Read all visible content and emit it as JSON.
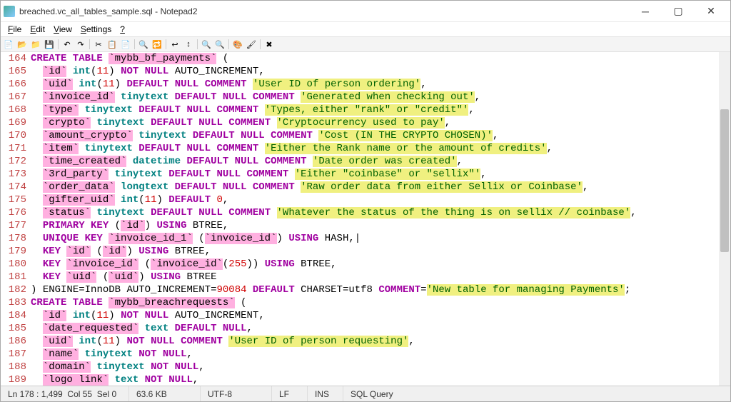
{
  "window": {
    "title": "breached.vc_all_tables_sample.sql - Notepad2"
  },
  "menu": {
    "file": "File",
    "edit": "Edit",
    "view": "View",
    "settings": "Settings",
    "help": "?"
  },
  "toolbar": {
    "icons": [
      "new-icon",
      "open-icon",
      "browse-icon",
      "save-icon",
      "sep",
      "undo-icon",
      "redo-icon",
      "sep",
      "cut-icon",
      "copy-icon",
      "paste-icon",
      "sep",
      "find-icon",
      "replace-icon",
      "sep",
      "wordwrap-icon",
      "wrapline-icon",
      "sep",
      "zoomin-icon",
      "zoomout-icon",
      "sep",
      "scheme-icon",
      "scheme2-icon",
      "sep",
      "exit-icon"
    ]
  },
  "lines": [
    {
      "n": 164,
      "tokens": [
        [
          "kw",
          "CREATE TABLE "
        ],
        [
          "ident",
          "`mybb_bf_payments`"
        ],
        [
          "pn",
          " ("
        ]
      ]
    },
    {
      "n": 165,
      "tokens": [
        [
          "pn",
          "  "
        ],
        [
          "ident",
          "`id`"
        ],
        [
          "pn",
          " "
        ],
        [
          "dtype",
          "int"
        ],
        [
          "pn",
          "("
        ],
        [
          "num",
          "11"
        ],
        [
          "pn",
          ") "
        ],
        [
          "attr",
          "NOT NULL"
        ],
        [
          "pn",
          " "
        ],
        [
          "fn",
          "AUTO_INCREMENT"
        ],
        [
          "pn",
          ","
        ]
      ]
    },
    {
      "n": 166,
      "tokens": [
        [
          "pn",
          "  "
        ],
        [
          "ident",
          "`uid`"
        ],
        [
          "pn",
          " "
        ],
        [
          "dtype",
          "int"
        ],
        [
          "pn",
          "("
        ],
        [
          "num",
          "11"
        ],
        [
          "pn",
          ") "
        ],
        [
          "attr",
          "DEFAULT NULL"
        ],
        [
          "pn",
          " "
        ],
        [
          "kw",
          "COMMENT "
        ],
        [
          "str",
          "'User ID of person ordering'"
        ],
        [
          "pn",
          ","
        ]
      ]
    },
    {
      "n": 167,
      "tokens": [
        [
          "pn",
          "  "
        ],
        [
          "ident",
          "`invoice_id`"
        ],
        [
          "pn",
          " "
        ],
        [
          "dtype",
          "tinytext "
        ],
        [
          "attr",
          "DEFAULT NULL"
        ],
        [
          "pn",
          " "
        ],
        [
          "kw",
          "COMMENT "
        ],
        [
          "str",
          "'Generated when checking out'"
        ],
        [
          "pn",
          ","
        ]
      ]
    },
    {
      "n": 168,
      "tokens": [
        [
          "pn",
          "  "
        ],
        [
          "ident",
          "`type`"
        ],
        [
          "pn",
          " "
        ],
        [
          "dtype",
          "tinytext "
        ],
        [
          "attr",
          "DEFAULT NULL"
        ],
        [
          "pn",
          " "
        ],
        [
          "kw",
          "COMMENT "
        ],
        [
          "str",
          "'Types, either \"rank\" or \"credit\"'"
        ],
        [
          "pn",
          ","
        ]
      ]
    },
    {
      "n": 169,
      "tokens": [
        [
          "pn",
          "  "
        ],
        [
          "ident",
          "`crypto`"
        ],
        [
          "pn",
          " "
        ],
        [
          "dtype",
          "tinytext "
        ],
        [
          "attr",
          "DEFAULT NULL"
        ],
        [
          "pn",
          " "
        ],
        [
          "kw",
          "COMMENT "
        ],
        [
          "str",
          "'Cryptocurrency used to pay'"
        ],
        [
          "pn",
          ","
        ]
      ]
    },
    {
      "n": 170,
      "tokens": [
        [
          "pn",
          "  "
        ],
        [
          "ident",
          "`amount_crypto`"
        ],
        [
          "pn",
          " "
        ],
        [
          "dtype",
          "tinytext "
        ],
        [
          "attr",
          "DEFAULT NULL"
        ],
        [
          "pn",
          " "
        ],
        [
          "kw",
          "COMMENT "
        ],
        [
          "str",
          "'Cost (IN THE CRYPTO CHOSEN)'"
        ],
        [
          "pn",
          ","
        ]
      ]
    },
    {
      "n": 171,
      "tokens": [
        [
          "pn",
          "  "
        ],
        [
          "ident",
          "`item`"
        ],
        [
          "pn",
          " "
        ],
        [
          "dtype",
          "tinytext "
        ],
        [
          "attr",
          "DEFAULT NULL"
        ],
        [
          "pn",
          " "
        ],
        [
          "kw",
          "COMMENT "
        ],
        [
          "str",
          "'Either the Rank name or the amount of credits'"
        ],
        [
          "pn",
          ","
        ]
      ]
    },
    {
      "n": 172,
      "tokens": [
        [
          "pn",
          "  "
        ],
        [
          "ident",
          "`time_created`"
        ],
        [
          "pn",
          " "
        ],
        [
          "dtype",
          "datetime "
        ],
        [
          "attr",
          "DEFAULT NULL"
        ],
        [
          "pn",
          " "
        ],
        [
          "kw",
          "COMMENT "
        ],
        [
          "str",
          "'Date order was created'"
        ],
        [
          "pn",
          ","
        ]
      ]
    },
    {
      "n": 173,
      "tokens": [
        [
          "pn",
          "  "
        ],
        [
          "ident",
          "`3rd_party`"
        ],
        [
          "pn",
          " "
        ],
        [
          "dtype",
          "tinytext "
        ],
        [
          "attr",
          "DEFAULT NULL"
        ],
        [
          "pn",
          " "
        ],
        [
          "kw",
          "COMMENT "
        ],
        [
          "str",
          "'Either \"coinbase\" or \"sellix\"'"
        ],
        [
          "pn",
          ","
        ]
      ]
    },
    {
      "n": 174,
      "tokens": [
        [
          "pn",
          "  "
        ],
        [
          "ident",
          "`order_data`"
        ],
        [
          "pn",
          " "
        ],
        [
          "dtype",
          "longtext "
        ],
        [
          "attr",
          "DEFAULT NULL"
        ],
        [
          "pn",
          " "
        ],
        [
          "kw",
          "COMMENT "
        ],
        [
          "str",
          "'Raw order data from either Sellix or Coinbase'"
        ],
        [
          "pn",
          ","
        ]
      ]
    },
    {
      "n": 175,
      "tokens": [
        [
          "pn",
          "  "
        ],
        [
          "ident",
          "`gifter_uid`"
        ],
        [
          "pn",
          " "
        ],
        [
          "dtype",
          "int"
        ],
        [
          "pn",
          "("
        ],
        [
          "num",
          "11"
        ],
        [
          "pn",
          ") "
        ],
        [
          "attr",
          "DEFAULT "
        ],
        [
          "num",
          "0"
        ],
        [
          "pn",
          ","
        ]
      ]
    },
    {
      "n": 176,
      "tokens": [
        [
          "pn",
          "  "
        ],
        [
          "ident",
          "`status`"
        ],
        [
          "pn",
          " "
        ],
        [
          "dtype",
          "tinytext "
        ],
        [
          "attr",
          "DEFAULT NULL"
        ],
        [
          "pn",
          " "
        ],
        [
          "kw",
          "COMMENT "
        ],
        [
          "str",
          "'Whatever the status of the thing is on sellix // coinbase'"
        ],
        [
          "pn",
          ","
        ]
      ]
    },
    {
      "n": 177,
      "tokens": [
        [
          "pn",
          "  "
        ],
        [
          "kw",
          "PRIMARY KEY "
        ],
        [
          "pn",
          "("
        ],
        [
          "ident",
          "`id`"
        ],
        [
          "pn",
          ") "
        ],
        [
          "kw",
          "USING "
        ],
        [
          "fn",
          "BTREE"
        ],
        [
          "pn",
          ","
        ]
      ]
    },
    {
      "n": 178,
      "tokens": [
        [
          "pn",
          "  "
        ],
        [
          "kw",
          "UNIQUE KEY "
        ],
        [
          "ident",
          "`invoice_id_1`"
        ],
        [
          "pn",
          " ("
        ],
        [
          "ident",
          "`invoice_id`"
        ],
        [
          "pn",
          ") "
        ],
        [
          "kw",
          "USING "
        ],
        [
          "fn",
          "HASH"
        ],
        [
          "pn",
          ",|"
        ]
      ]
    },
    {
      "n": 179,
      "tokens": [
        [
          "pn",
          "  "
        ],
        [
          "kw",
          "KEY "
        ],
        [
          "ident",
          "`id`"
        ],
        [
          "pn",
          " ("
        ],
        [
          "ident",
          "`id`"
        ],
        [
          "pn",
          ") "
        ],
        [
          "kw",
          "USING "
        ],
        [
          "fn",
          "BTREE"
        ],
        [
          "pn",
          ","
        ]
      ]
    },
    {
      "n": 180,
      "tokens": [
        [
          "pn",
          "  "
        ],
        [
          "kw",
          "KEY "
        ],
        [
          "ident",
          "`invoice_id`"
        ],
        [
          "pn",
          " ("
        ],
        [
          "ident",
          "`invoice_id`"
        ],
        [
          "pn",
          "("
        ],
        [
          "num",
          "255"
        ],
        [
          "pn",
          ")) "
        ],
        [
          "kw",
          "USING "
        ],
        [
          "fn",
          "BTREE"
        ],
        [
          "pn",
          ","
        ]
      ]
    },
    {
      "n": 181,
      "tokens": [
        [
          "pn",
          "  "
        ],
        [
          "kw",
          "KEY "
        ],
        [
          "ident",
          "`uid`"
        ],
        [
          "pn",
          " ("
        ],
        [
          "ident",
          "`uid`"
        ],
        [
          "pn",
          ") "
        ],
        [
          "kw",
          "USING "
        ],
        [
          "fn",
          "BTREE"
        ]
      ]
    },
    {
      "n": 182,
      "tokens": [
        [
          "pn",
          ") "
        ],
        [
          "fn",
          "ENGINE"
        ],
        [
          "pn",
          "="
        ],
        [
          "fn",
          "InnoDB "
        ],
        [
          "fn",
          "AUTO_INCREMENT"
        ],
        [
          "pn",
          "="
        ],
        [
          "num",
          "90084"
        ],
        [
          "pn",
          " "
        ],
        [
          "attr",
          "DEFAULT "
        ],
        [
          "fn",
          "CHARSET"
        ],
        [
          "pn",
          "="
        ],
        [
          "fn",
          "utf8 "
        ],
        [
          "kw",
          "COMMENT"
        ],
        [
          "pn",
          "="
        ],
        [
          "str",
          "'New table for managing Payments'"
        ],
        [
          "pn",
          ";"
        ]
      ]
    },
    {
      "n": 183,
      "tokens": [
        [
          "kw",
          "CREATE TABLE "
        ],
        [
          "ident",
          "`mybb_breachrequests`"
        ],
        [
          "pn",
          " ("
        ]
      ]
    },
    {
      "n": 184,
      "tokens": [
        [
          "pn",
          "  "
        ],
        [
          "ident",
          "`id`"
        ],
        [
          "pn",
          " "
        ],
        [
          "dtype",
          "int"
        ],
        [
          "pn",
          "("
        ],
        [
          "num",
          "11"
        ],
        [
          "pn",
          ") "
        ],
        [
          "attr",
          "NOT NULL"
        ],
        [
          "pn",
          " "
        ],
        [
          "fn",
          "AUTO_INCREMENT"
        ],
        [
          "pn",
          ","
        ]
      ]
    },
    {
      "n": 185,
      "tokens": [
        [
          "pn",
          "  "
        ],
        [
          "ident",
          "`date_requested`"
        ],
        [
          "pn",
          " "
        ],
        [
          "dtype",
          "text "
        ],
        [
          "attr",
          "DEFAULT NULL"
        ],
        [
          "pn",
          ","
        ]
      ]
    },
    {
      "n": 186,
      "tokens": [
        [
          "pn",
          "  "
        ],
        [
          "ident",
          "`uid`"
        ],
        [
          "pn",
          " "
        ],
        [
          "dtype",
          "int"
        ],
        [
          "pn",
          "("
        ],
        [
          "num",
          "11"
        ],
        [
          "pn",
          ") "
        ],
        [
          "attr",
          "NOT NULL"
        ],
        [
          "pn",
          " "
        ],
        [
          "kw",
          "COMMENT "
        ],
        [
          "str",
          "'User ID of person requesting'"
        ],
        [
          "pn",
          ","
        ]
      ]
    },
    {
      "n": 187,
      "tokens": [
        [
          "pn",
          "  "
        ],
        [
          "ident",
          "`name`"
        ],
        [
          "pn",
          " "
        ],
        [
          "dtype",
          "tinytext "
        ],
        [
          "attr",
          "NOT NULL"
        ],
        [
          "pn",
          ","
        ]
      ]
    },
    {
      "n": 188,
      "tokens": [
        [
          "pn",
          "  "
        ],
        [
          "ident",
          "`domain`"
        ],
        [
          "pn",
          " "
        ],
        [
          "dtype",
          "tinytext "
        ],
        [
          "attr",
          "NOT NULL"
        ],
        [
          "pn",
          ","
        ]
      ]
    },
    {
      "n": 189,
      "tokens": [
        [
          "pn",
          "  "
        ],
        [
          "ident",
          "`logo link`"
        ],
        [
          "pn",
          " "
        ],
        [
          "dtype",
          "text "
        ],
        [
          "attr",
          "NOT NULL"
        ],
        [
          "pn",
          ","
        ]
      ]
    }
  ],
  "status": {
    "pos": "Ln 178 : 1,499",
    "col": "Col 55",
    "sel": "Sel 0",
    "size": "63.6 KB",
    "encoding": "UTF-8",
    "eol": "LF",
    "mode": "INS",
    "language": "SQL Query"
  }
}
